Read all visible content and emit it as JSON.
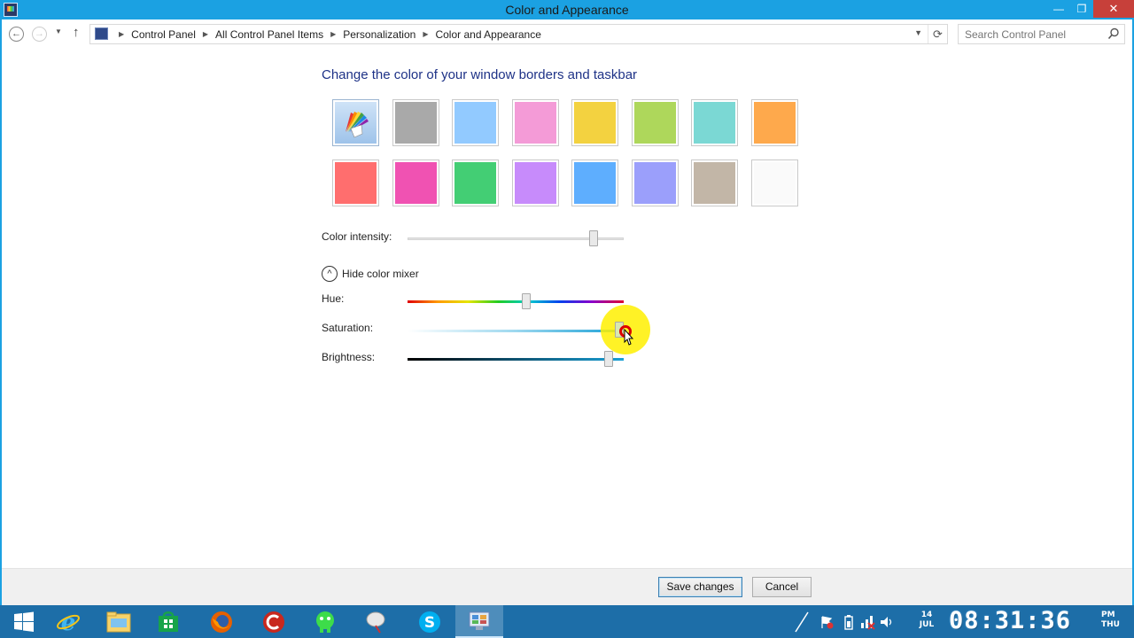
{
  "window": {
    "title": "Color and Appearance",
    "minimize_glyph": "—",
    "restore_glyph": "❐",
    "close_glyph": "✕"
  },
  "address": {
    "breadcrumbs": [
      "Control Panel",
      "All Control Panel Items",
      "Personalization",
      "Color and Appearance"
    ],
    "search_placeholder": "Search Control Panel"
  },
  "content": {
    "heading": "Change the color of your window borders and taskbar",
    "swatches": [
      {
        "name": "automatic",
        "color": "auto"
      },
      {
        "name": "gray",
        "color": "#a9a9a9"
      },
      {
        "name": "light-blue",
        "color": "#92caff"
      },
      {
        "name": "pink",
        "color": "#f49bd7"
      },
      {
        "name": "yellow",
        "color": "#f3d240"
      },
      {
        "name": "green-yellow",
        "color": "#aed75b"
      },
      {
        "name": "teal",
        "color": "#7bd8d4"
      },
      {
        "name": "orange",
        "color": "#fea94c"
      },
      {
        "name": "red",
        "color": "#ff6e6e"
      },
      {
        "name": "magenta",
        "color": "#f052b2"
      },
      {
        "name": "green",
        "color": "#43ce74"
      },
      {
        "name": "purple",
        "color": "#c78bfb"
      },
      {
        "name": "blue",
        "color": "#5eaefe"
      },
      {
        "name": "lavender",
        "color": "#9b9ffb"
      },
      {
        "name": "taupe",
        "color": "#c2b6a7"
      },
      {
        "name": "white",
        "color": "#fafafa"
      }
    ],
    "color_intensity_label": "Color intensity:",
    "color_intensity_value": 0.86,
    "mixer_toggle_label": "Hide color mixer",
    "hue_label": "Hue:",
    "hue_value": 0.55,
    "saturation_label": "Saturation:",
    "saturation_value": 0.98,
    "brightness_label": "Brightness:",
    "brightness_value": 0.93
  },
  "footer": {
    "save_label": "Save changes",
    "cancel_label": "Cancel"
  },
  "taskbar": {
    "apps": [
      "start",
      "internet-explorer",
      "file-explorer",
      "store",
      "firefox",
      "ccleaner",
      "android-app",
      "satellite-app",
      "skype",
      "control-panel"
    ],
    "active_app": "control-panel",
    "date_day": "14",
    "date_month": "JUL",
    "time": "08:31:36",
    "ampm": "PM",
    "weekday": "THU"
  },
  "colors": {
    "accent": "#1ba1e2",
    "taskbar": "#1d6ea8",
    "heading": "#1e3287",
    "close": "#c7403a"
  }
}
